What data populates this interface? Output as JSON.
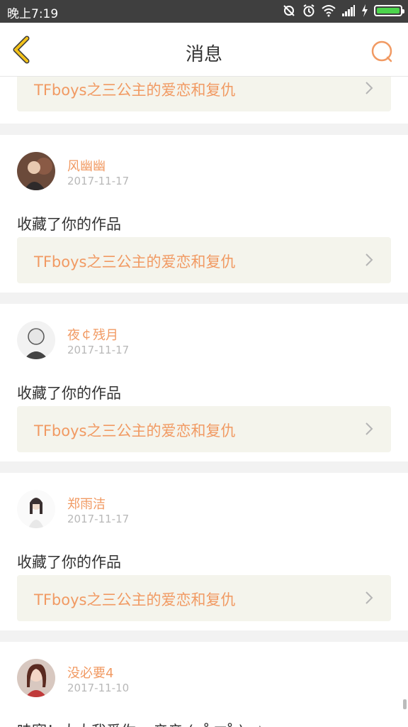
{
  "status_bar": {
    "time": "晚上7:19"
  },
  "header": {
    "title": "消息"
  },
  "colors": {
    "accent": "#f19a63",
    "back_arrow": "#f3c21b",
    "card_bg": "#f4f4ec"
  },
  "notifications": [
    {
      "work_title": "TFboys之三公主的爱恋和复仇"
    },
    {
      "user": "风幽幽",
      "date": "2017-11-17",
      "message": "收藏了你的作品",
      "work_title": "TFboys之三公主的爱恋和复仇"
    },
    {
      "user": "夜￠残月",
      "date": "2017-11-17",
      "message": "收藏了你的作品",
      "work_title": "TFboys之三公主的爱恋和复仇"
    },
    {
      "user": "郑雨洁",
      "date": "2017-11-17",
      "message": "收藏了你的作品",
      "work_title": "TFboys之三公主的爱恋和复仇"
    },
    {
      "user": "没必要4",
      "date": "2017-11-10",
      "message": "哇塞！大大我爱你~ 亲亲 (o˚ ▽˚ )o☆"
    }
  ]
}
